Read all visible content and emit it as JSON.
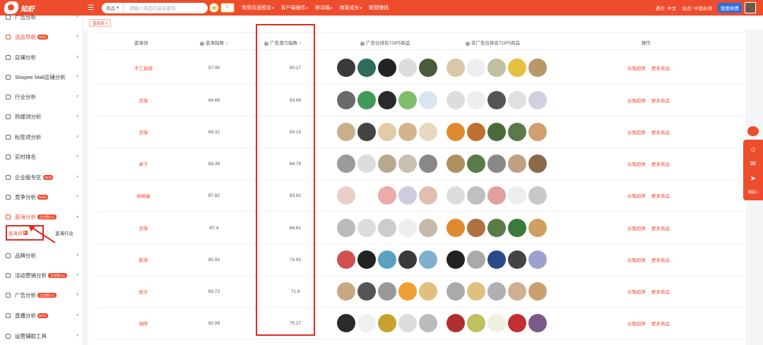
{
  "topbar": {
    "logo_text": "知虾",
    "search_category": "商品",
    "search_placeholder": "请输入商品ID或关键词",
    "nav": [
      "常用页面预设",
      "客户端插件",
      "移动端",
      "商家成长",
      "联盟赚钱"
    ],
    "lang_label": "语言: 中文",
    "site_label": "站点: 中国台湾",
    "upgrade_label": "我要续费"
  },
  "sidebar": {
    "items": [
      {
        "label": "广告分析"
      },
      {
        "label": "选品导航",
        "badge": "NEW"
      },
      {
        "label": "店铺分析"
      },
      {
        "label": "Shopee Mall店铺分析"
      },
      {
        "label": "行业分析"
      },
      {
        "label": "热搜词分析"
      },
      {
        "label": "标签词分析"
      },
      {
        "label": "实时排名"
      },
      {
        "label": "企业版专区",
        "badge": "NEW"
      },
      {
        "label": "竞争分析",
        "badge": "NEW"
      },
      {
        "label": "蓝海分析",
        "badge": "企业版LLL"
      },
      {
        "label": "品牌分析"
      },
      {
        "label": "活动营销分析",
        "badge": "企业版LLL"
      },
      {
        "label": "广告分析",
        "badge": "企业版LLL"
      },
      {
        "label": "直播分析",
        "badge": "NEW"
      },
      {
        "label": "运营辅助工具"
      }
    ],
    "sub_active": "蓝海词",
    "sub_active_tag": "新",
    "sub_other": "蓝海行业"
  },
  "tabstrip": {
    "tab_label": "蓝海词 ×"
  },
  "table": {
    "headers": {
      "keyword": "蓝海词",
      "blue_index": "蓝海指数",
      "ad_potential": "广告潜力指数",
      "ad_top5": "广告位排名TOP5商品",
      "non_ad_top5": "非广告位排名TOP5商品",
      "action": "操作"
    },
    "rows": [
      {
        "keyword": "手工具组",
        "blue_index": "97.95",
        "ad_potential": "90.17"
      },
      {
        "keyword": "衣架",
        "blue_index": "94.68",
        "ad_potential": "93.88"
      },
      {
        "keyword": "沥架",
        "blue_index": "89.32",
        "ad_potential": "83.15"
      },
      {
        "keyword": "桌子",
        "blue_index": "88.39",
        "ad_potential": "64.79"
      },
      {
        "keyword": "收纳盒",
        "blue_index": "87.82",
        "ad_potential": "83.92"
      },
      {
        "keyword": "沥架",
        "blue_index": "87.4",
        "ad_potential": "84.61"
      },
      {
        "keyword": "胶带",
        "blue_index": "85.93",
        "ad_potential": "74.93"
      },
      {
        "keyword": "枕头",
        "blue_index": "83.72",
        "ad_potential": "71.8"
      },
      {
        "keyword": "咖啡",
        "blue_index": "82.99",
        "ad_potential": "75.27"
      }
    ],
    "action_primary": "谷歌趋势",
    "action_secondary": "更多商品"
  },
  "float_panel": {
    "collapse_label": "收起>"
  },
  "colors": {
    "accent": "#ee4d2d",
    "annotation": "#e02b20"
  }
}
